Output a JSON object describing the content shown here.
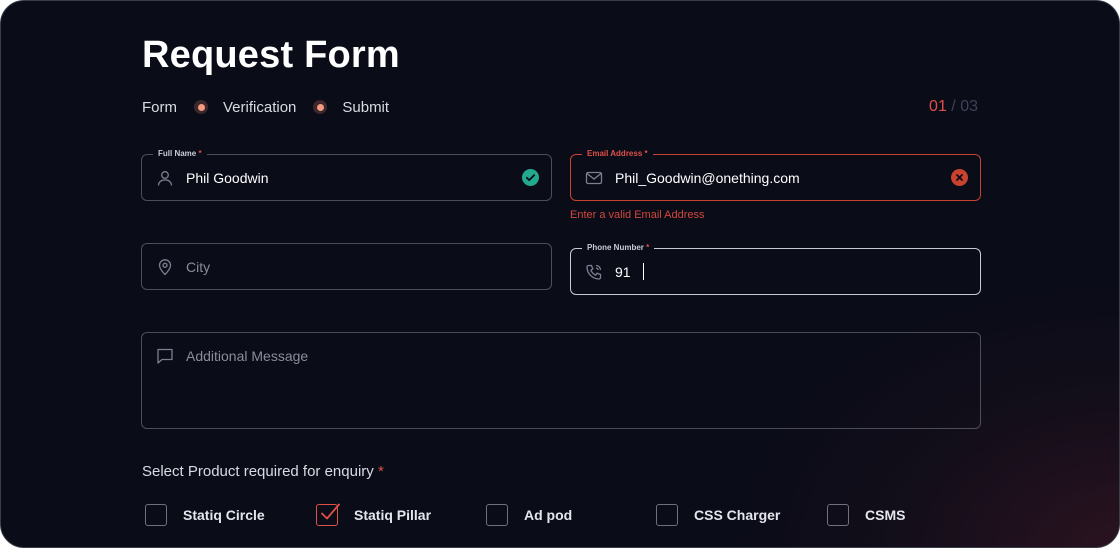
{
  "title": "Request Form",
  "steps": [
    "Form",
    "Verification",
    "Submit"
  ],
  "step_count": {
    "current": "01",
    "separator": "/",
    "total": "03"
  },
  "fields": {
    "full_name": {
      "label": "Full Name",
      "required_mark": "*",
      "value": "Phil Goodwin",
      "status": "valid"
    },
    "email": {
      "label": "Email Address",
      "required_mark": "*",
      "value": "Phil_Goodwin@onething.com",
      "status": "invalid",
      "error": "Enter a valid Email Address"
    },
    "city": {
      "placeholder": "City"
    },
    "phone": {
      "label": "Phone Number",
      "required_mark": "*",
      "value": "91"
    },
    "message": {
      "placeholder": "Additional Message"
    }
  },
  "products": {
    "label": "Select Product required for enquiry",
    "required_mark": "*",
    "items": [
      {
        "label": "Statiq Circle",
        "checked": false
      },
      {
        "label": "Statiq Pillar",
        "checked": true
      },
      {
        "label": "Ad pod",
        "checked": false
      },
      {
        "label": "CSS Charger",
        "checked": false
      },
      {
        "label": "CSMS",
        "checked": false
      }
    ]
  },
  "colors": {
    "background": "#0a0c18",
    "accent": "#e0504a",
    "success": "#23a98e",
    "error": "#c9412f"
  }
}
